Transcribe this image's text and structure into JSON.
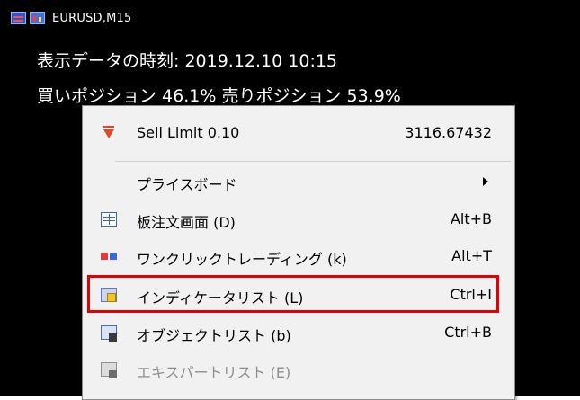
{
  "chart": {
    "symbol": "EURUSD,M15",
    "time_line": "表示データの時刻: 2019.12.10 10:15",
    "position_line": "買いポジション 46.1% 売りポジション 53.9%"
  },
  "menu": {
    "items": [
      {
        "label": "Sell Limit 0.10",
        "shortcut": "3116.67432",
        "icon": "sell-limit-icon"
      },
      {
        "label": "プライスボード",
        "shortcut": "",
        "icon": "none",
        "submenu": true
      },
      {
        "label": "板注文画面 (D)",
        "shortcut": "Alt+B",
        "icon": "depth-of-market-icon"
      },
      {
        "label": "ワンクリックトレーディング (k)",
        "shortcut": "Alt+T",
        "icon": "one-click-trading-icon"
      },
      {
        "label": "インディケータリスト (L)",
        "shortcut": "Ctrl+I",
        "icon": "indicator-list-icon"
      },
      {
        "label": "オブジェクトリスト (b)",
        "shortcut": "Ctrl+B",
        "icon": "object-list-icon"
      },
      {
        "label": "エキスパートリスト (E)",
        "shortcut": "",
        "icon": "expert-list-icon",
        "disabled": true
      }
    ]
  },
  "colors": {
    "chart_background": "#000000",
    "menu_background": "#f1f1f1",
    "highlight_border": "#e30000"
  }
}
